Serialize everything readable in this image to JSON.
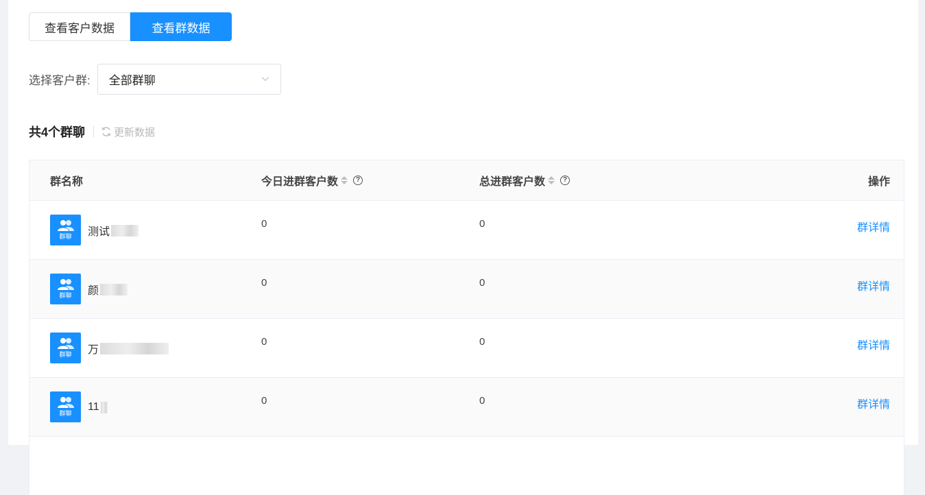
{
  "tabs": [
    {
      "label": "查看客户数据",
      "active": false
    },
    {
      "label": "查看群数据",
      "active": true
    }
  ],
  "filter": {
    "label": "选择客户群:",
    "selected": "全部群聊"
  },
  "summary": {
    "title": "共4个群聊",
    "refresh_label": "更新数据"
  },
  "table": {
    "headers": {
      "name": "群名称",
      "today": "今日进群客户数",
      "total": "总进群客户数",
      "action": "操作"
    },
    "rows": [
      {
        "name": "测试",
        "today": "0",
        "total": "0",
        "action": "群详情",
        "avatar_text": "群聊"
      },
      {
        "name": "颜",
        "today": "0",
        "total": "0",
        "action": "群详情",
        "avatar_text": "群聊"
      },
      {
        "name": "万",
        "today": "0",
        "total": "0",
        "action": "群详情",
        "avatar_text": "群聊"
      },
      {
        "name": "11",
        "today": "0",
        "total": "0",
        "action": "群详情",
        "avatar_text": "群聊"
      }
    ]
  },
  "colors": {
    "accent": "#1890ff"
  }
}
